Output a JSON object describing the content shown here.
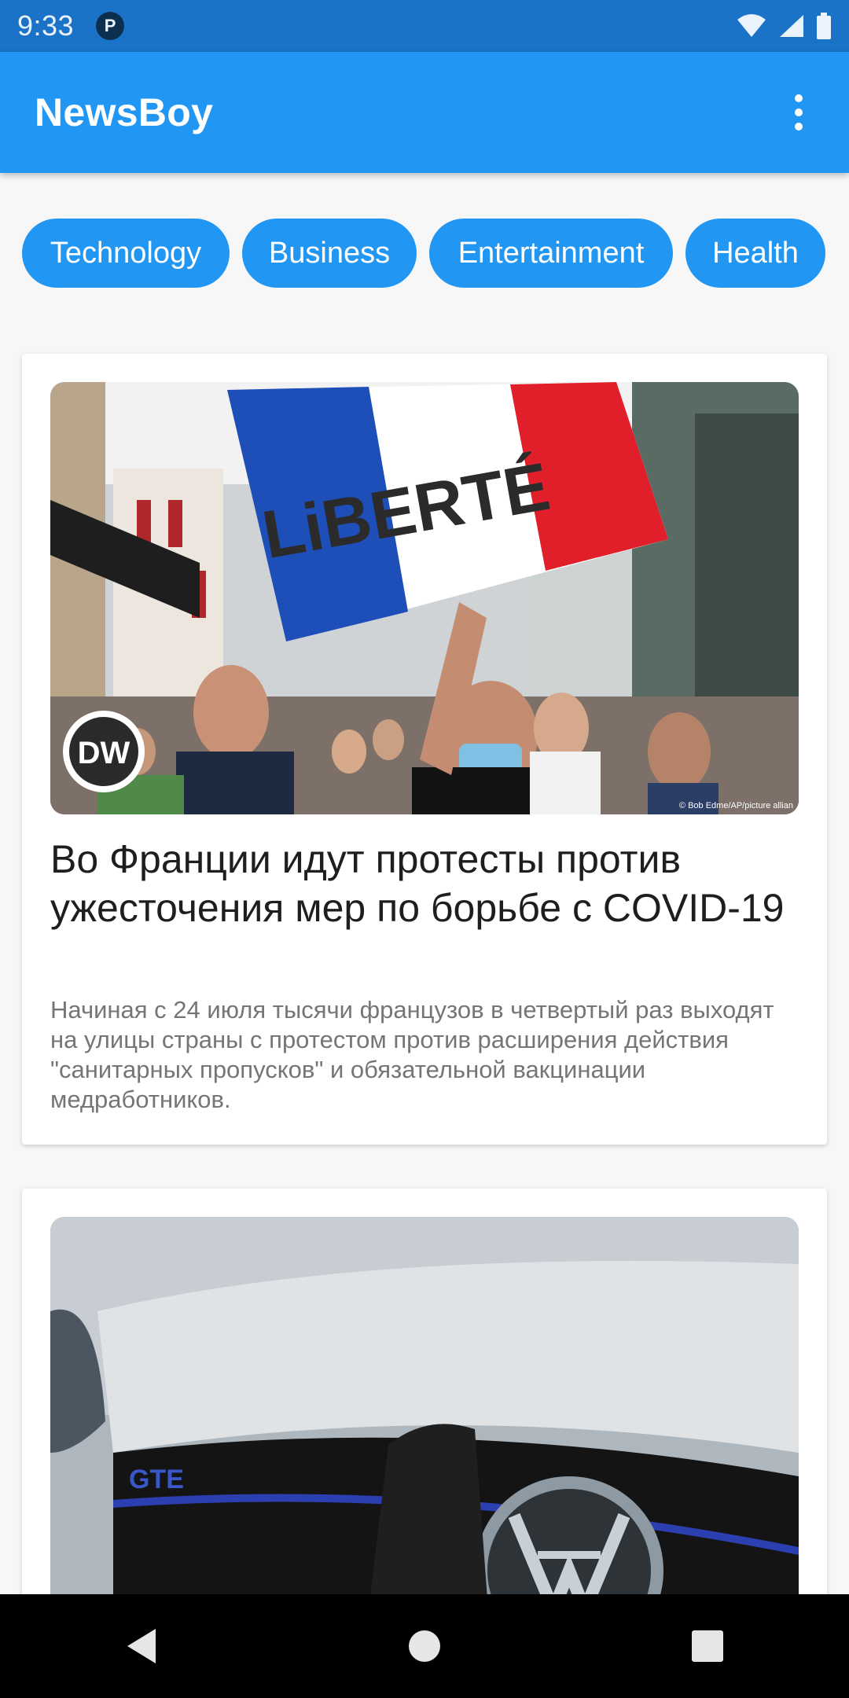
{
  "status_bar": {
    "time": "9:33",
    "app_icon_letter": "P",
    "icons": [
      "wifi-icon",
      "signal-icon",
      "battery-icon"
    ]
  },
  "app_bar": {
    "title": "NewsBoy",
    "menu_icon": "overflow-menu-icon"
  },
  "categories": [
    {
      "label": "Technology"
    },
    {
      "label": "Business"
    },
    {
      "label": "Entertainment"
    },
    {
      "label": "Health"
    }
  ],
  "articles": [
    {
      "title": "Во Франции идут протесты против ужесточения мер по борьбе с COVID-19",
      "description": "Начиная с 24 июля тысячи французов в четвертый раз выходят на улицы страны с протестом против расширения действия \"санитарных пропусков\" и обязательной вакцинации медработников.",
      "image_logo": "DW",
      "image_sign": "LiBERTÉ",
      "image_credit": "© Bob Edme/AP/picture allian"
    },
    {
      "image_badge": "GTE"
    }
  ],
  "nav_bar": {
    "icons": [
      "back-icon",
      "home-icon",
      "recents-icon"
    ]
  },
  "colors": {
    "primary": "#2196f3",
    "status_bar": "#1a73c7",
    "background": "#f7f7f7"
  }
}
